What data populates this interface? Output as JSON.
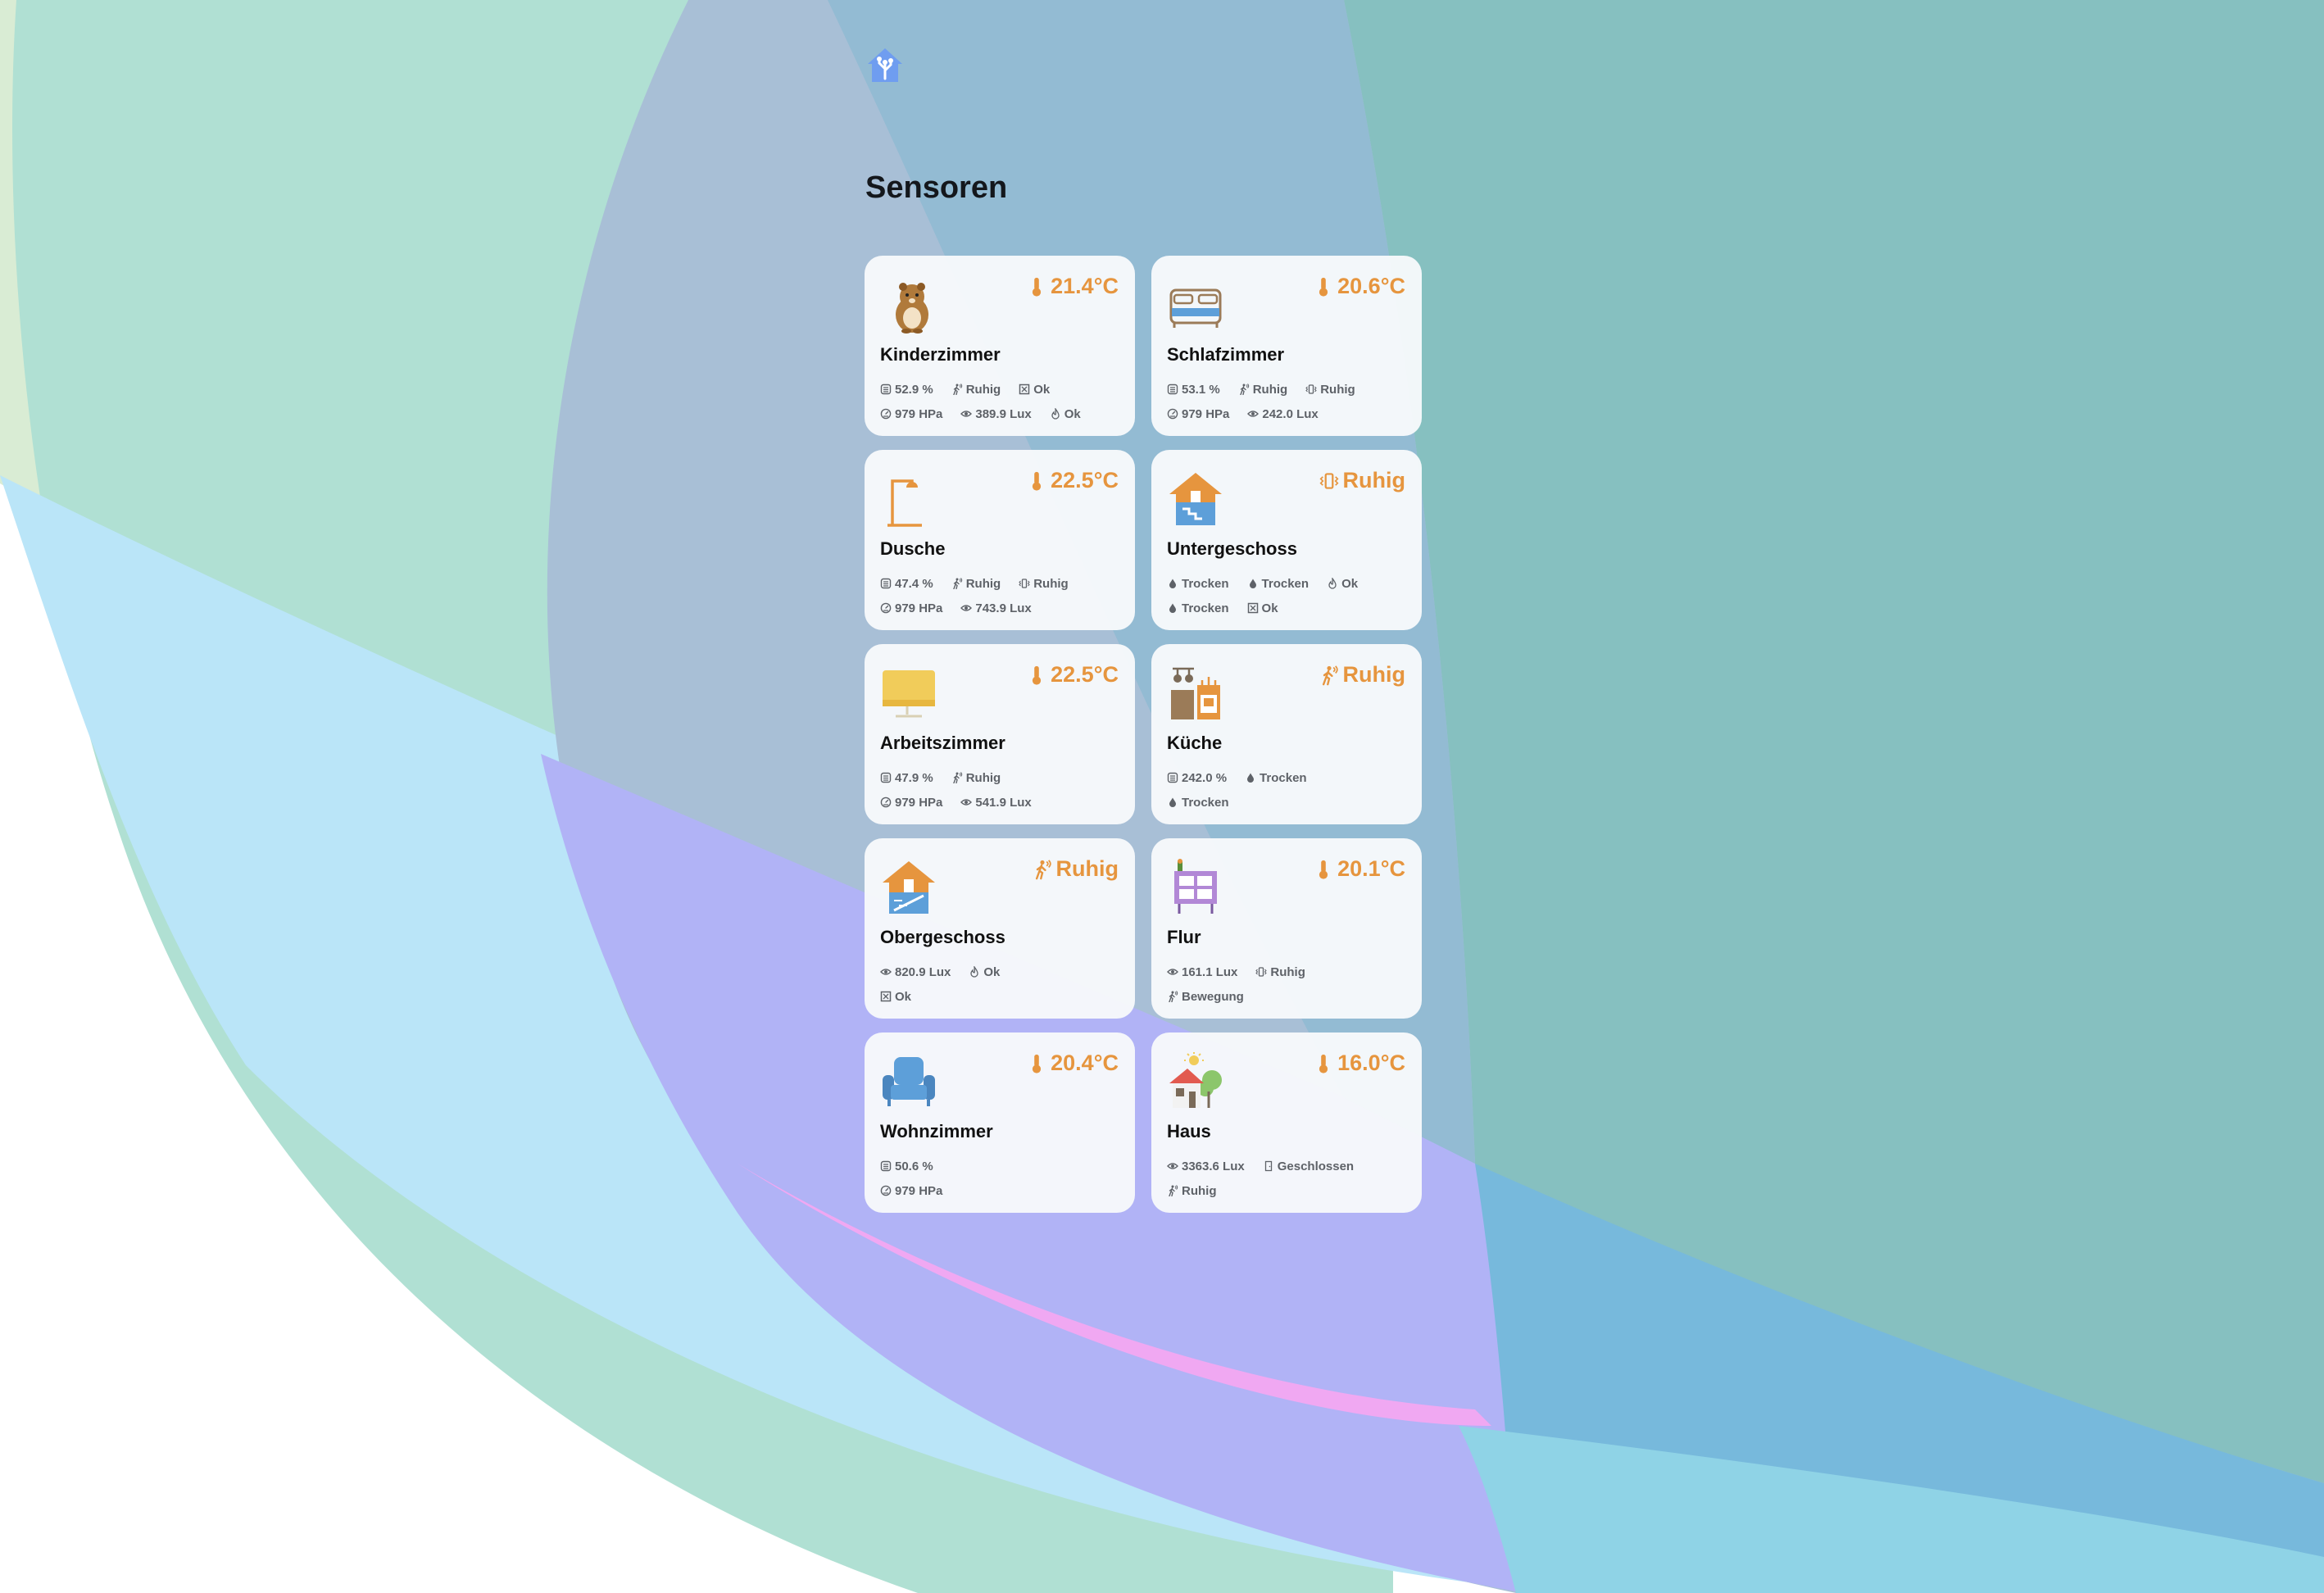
{
  "page": {
    "title": "Sensoren"
  },
  "colors": {
    "accent": "#e6953e",
    "card_bg": "#f7f9fb",
    "text_main": "#111111",
    "text_muted": "#5e6268",
    "logo": "#6f9df0"
  },
  "rooms": [
    {
      "name": "Kinderzimmer",
      "icon": "hamster-icon",
      "headline": {
        "icon": "thermometer-icon",
        "value": "21.4°C"
      },
      "rows": [
        [
          {
            "icon": "humidity-icon",
            "text": "52.9 %"
          },
          {
            "icon": "motion-icon",
            "text": "Ruhig"
          },
          {
            "icon": "window-icon",
            "text": "Ok"
          }
        ],
        [
          {
            "icon": "pressure-icon",
            "text": "979 HPa"
          },
          {
            "icon": "eye-icon",
            "text": "389.9 Lux"
          },
          {
            "icon": "flame-icon",
            "text": "Ok"
          }
        ]
      ]
    },
    {
      "name": "Schlafzimmer",
      "icon": "bed-icon",
      "headline": {
        "icon": "thermometer-icon",
        "value": "20.6°C"
      },
      "rows": [
        [
          {
            "icon": "humidity-icon",
            "text": "53.1 %"
          },
          {
            "icon": "motion-icon",
            "text": "Ruhig"
          },
          {
            "icon": "vibration-icon",
            "text": "Ruhig"
          }
        ],
        [
          {
            "icon": "pressure-icon",
            "text": "979 HPa"
          },
          {
            "icon": "eye-icon",
            "text": "242.0 Lux"
          }
        ]
      ]
    },
    {
      "name": "Dusche",
      "icon": "shower-icon",
      "headline": {
        "icon": "thermometer-icon",
        "value": "22.5°C"
      },
      "rows": [
        [
          {
            "icon": "humidity-icon",
            "text": "47.4 %"
          },
          {
            "icon": "motion-icon",
            "text": "Ruhig"
          },
          {
            "icon": "vibration-icon",
            "text": "Ruhig"
          }
        ],
        [
          {
            "icon": "pressure-icon",
            "text": "979 HPa"
          },
          {
            "icon": "eye-icon",
            "text": "743.9 Lux"
          }
        ]
      ]
    },
    {
      "name": "Untergeschoss",
      "icon": "house-basement-icon",
      "headline": {
        "icon": "vibration-icon",
        "value": "Ruhig"
      },
      "rows": [
        [
          {
            "icon": "water-drop-icon",
            "text": "Trocken"
          },
          {
            "icon": "water-drop-icon",
            "text": "Trocken"
          },
          {
            "icon": "flame-icon",
            "text": "Ok"
          }
        ],
        [
          {
            "icon": "water-drop-icon",
            "text": "Trocken"
          },
          {
            "icon": "window-icon",
            "text": "Ok"
          }
        ]
      ]
    },
    {
      "name": "Arbeitszimmer",
      "icon": "monitor-icon",
      "headline": {
        "icon": "thermometer-icon",
        "value": "22.5°C"
      },
      "rows": [
        [
          {
            "icon": "humidity-icon",
            "text": "47.9 %"
          },
          {
            "icon": "motion-icon",
            "text": "Ruhig"
          }
        ],
        [
          {
            "icon": "pressure-icon",
            "text": "979 HPa"
          },
          {
            "icon": "eye-icon",
            "text": "541.9 Lux"
          }
        ]
      ]
    },
    {
      "name": "Küche",
      "icon": "kitchen-icon",
      "headline": {
        "icon": "motion-icon",
        "value": "Ruhig"
      },
      "rows": [
        [
          {
            "icon": "humidity-icon",
            "text": "242.0 %"
          },
          {
            "icon": "water-drop-icon",
            "text": "Trocken"
          }
        ],
        [
          {
            "icon": "water-drop-icon",
            "text": "Trocken"
          }
        ]
      ]
    },
    {
      "name": "Obergeschoss",
      "icon": "house-upstairs-icon",
      "headline": {
        "icon": "motion-icon",
        "value": "Ruhig"
      },
      "rows": [
        [
          {
            "icon": "eye-icon",
            "text": "820.9 Lux"
          },
          {
            "icon": "flame-icon",
            "text": "Ok"
          }
        ],
        [
          {
            "icon": "window-icon",
            "text": "Ok"
          }
        ]
      ]
    },
    {
      "name": "Flur",
      "icon": "cabinet-icon",
      "headline": {
        "icon": "thermometer-icon",
        "value": "20.1°C"
      },
      "rows": [
        [
          {
            "icon": "eye-icon",
            "text": "161.1 Lux"
          },
          {
            "icon": "vibration-icon",
            "text": "Ruhig"
          }
        ],
        [
          {
            "icon": "motion-icon",
            "text": "Bewegung"
          }
        ]
      ]
    },
    {
      "name": "Wohnzimmer",
      "icon": "armchair-icon",
      "headline": {
        "icon": "thermometer-icon",
        "value": "20.4°C"
      },
      "rows": [
        [
          {
            "icon": "humidity-icon",
            "text": "50.6 %"
          }
        ],
        [
          {
            "icon": "pressure-icon",
            "text": "979 HPa"
          }
        ]
      ]
    },
    {
      "name": "Haus",
      "icon": "house-garden-icon",
      "headline": {
        "icon": "thermometer-icon",
        "value": "16.0°C"
      },
      "rows": [
        [
          {
            "icon": "eye-icon",
            "text": "3363.6 Lux"
          },
          {
            "icon": "door-icon",
            "text": "Geschlossen"
          }
        ],
        [
          {
            "icon": "motion-icon",
            "text": "Ruhig"
          }
        ]
      ]
    }
  ]
}
